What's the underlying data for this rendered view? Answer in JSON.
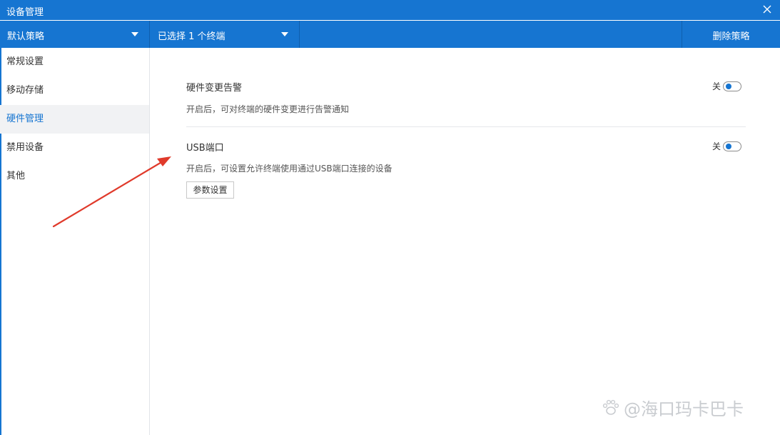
{
  "window": {
    "title": "设备管理"
  },
  "toolbar": {
    "policy_label": "默认策略",
    "terminal_label": "已选择 1 个终端",
    "delete_label": "删除策略"
  },
  "sidebar": {
    "items": [
      {
        "label": "常规设置"
      },
      {
        "label": "移动存储"
      },
      {
        "label": "硬件管理",
        "active": true
      },
      {
        "label": "禁用设备"
      },
      {
        "label": "其他"
      }
    ]
  },
  "main": {
    "hardware_alert": {
      "title": "硬件变更告警",
      "desc": "开启后，可对终端的硬件变更进行告警通知",
      "state": "关"
    },
    "usb_port": {
      "title": "USB端口",
      "desc": "开启后，可设置允许终端使用通过USB端口连接的设备",
      "state": "关",
      "param_button": "参数设置"
    }
  },
  "watermark": {
    "text": "@海口玛卡巴卡"
  },
  "colors": {
    "accent": "#1675d1",
    "annotation_arrow": "#e03a2b"
  }
}
